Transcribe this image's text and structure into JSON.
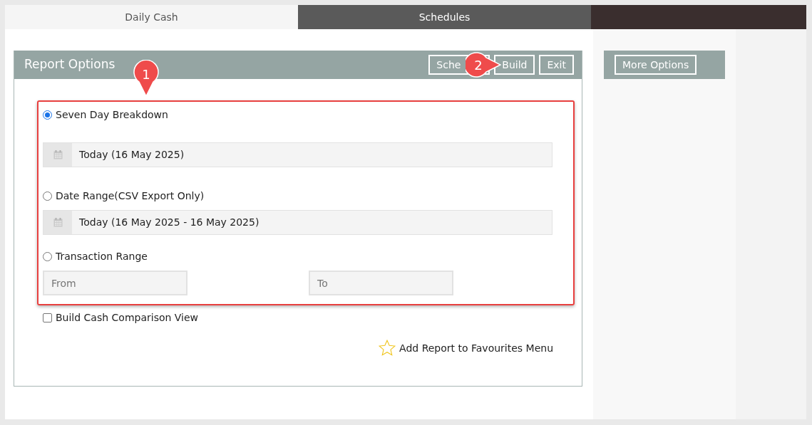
{
  "tabs": [
    {
      "label": "Daily Cash",
      "selected": true
    },
    {
      "label": "Schedules",
      "selected": false
    }
  ],
  "report_options": {
    "title": "Report Options",
    "buttons": [
      "Sche",
      "Build",
      "Exit"
    ],
    "options": [
      {
        "kind": "date",
        "label": "Seven Day Breakdown",
        "selected": true,
        "value": "Today (16 May 2025)"
      },
      {
        "kind": "date",
        "label": "Date Range(CSV Export Only)",
        "selected": false,
        "value": "Today (16 May 2025 - 16 May 2025)"
      },
      {
        "kind": "range",
        "label": "Transaction Range",
        "selected": false,
        "fields": [
          {
            "placeholder": "From"
          },
          {
            "placeholder": "To"
          }
        ]
      }
    ],
    "comparison": {
      "label": "Build Cash Comparison View",
      "checked": false
    },
    "favourites": {
      "label": "Add Report to Favourites Menu"
    }
  },
  "more_options": {
    "button": "More Options"
  },
  "callouts": [
    "1",
    "2"
  ]
}
